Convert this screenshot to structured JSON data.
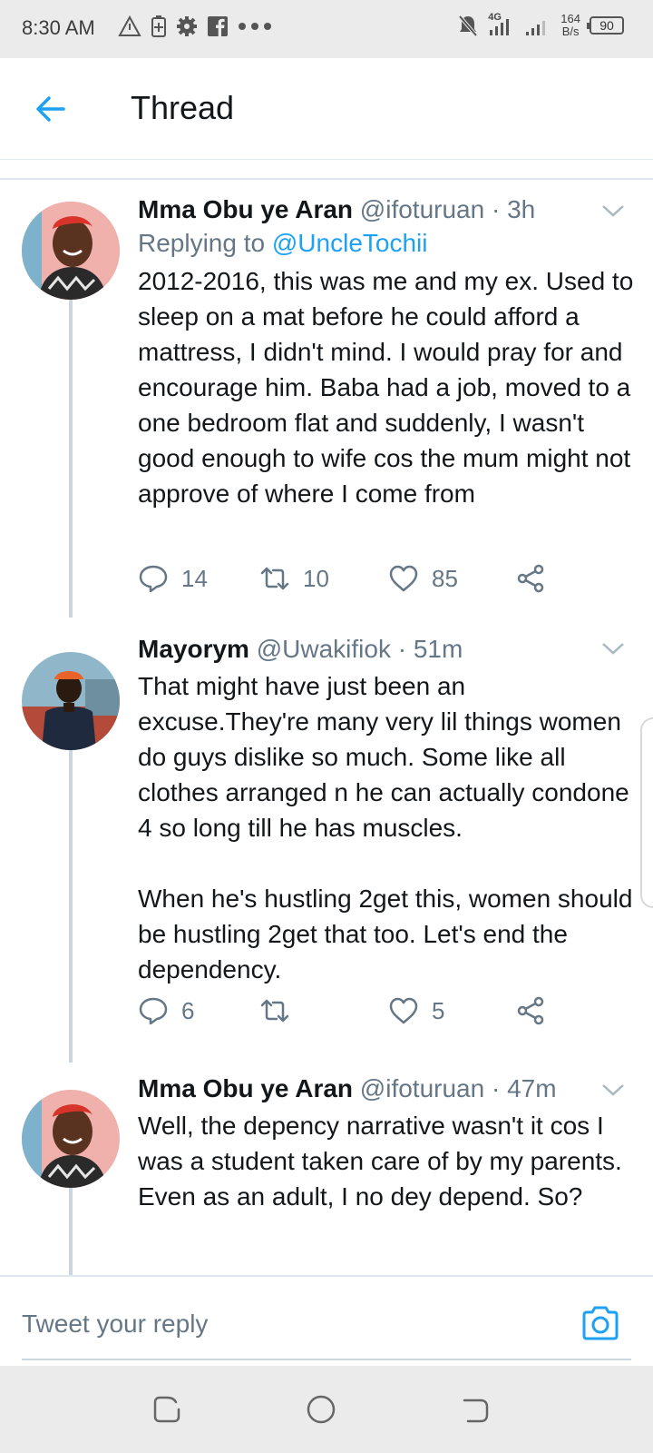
{
  "status_bar": {
    "time": "8:30 AM",
    "network": "4G",
    "speed_value": "164",
    "speed_unit": "B/s",
    "battery": "90"
  },
  "header": {
    "title": "Thread"
  },
  "tweets": [
    {
      "name": "Mma Obu ye Aran",
      "handle": "@ifoturuan",
      "time": "· 3h",
      "replying_prefix": "Replying to",
      "replying_to": "@UncleTochii",
      "text": "2012-2016, this was me and my ex. Used to sleep on a mat before he could afford a mattress, I didn't mind. I would pray for and encourage him. Baba had a job, moved to a one bedroom flat and suddenly, I wasn't good enough to wife cos the mum might not approve of where I come from",
      "replies": "14",
      "retweets": "10",
      "likes": "85"
    },
    {
      "name": "Mayorym",
      "handle": "@Uwakifiok",
      "time": "· 51m",
      "text": "That might have just been an excuse.They're many very lil things women do guys dislike so much. Some like all clothes arranged n he can actually condone 4 so long till he has muscles.\n\nWhen he's hustling 2get this, women should be hustling 2get that too. Let's end the dependency.",
      "replies": "6",
      "retweets": "",
      "likes": "5"
    },
    {
      "name": "Mma Obu ye Aran",
      "handle": "@ifoturuan",
      "time": "· 47m",
      "text": "Well, the depency narrative wasn't it cos I was a student taken care of by my parents. Even as an adult, I no dey depend. So?"
    }
  ],
  "reply_bar": {
    "placeholder": "Tweet your reply"
  },
  "colors": {
    "accent": "#1da1f2",
    "muted": "#657786",
    "text": "#14171a",
    "thread_line": "#ccd6dd"
  }
}
